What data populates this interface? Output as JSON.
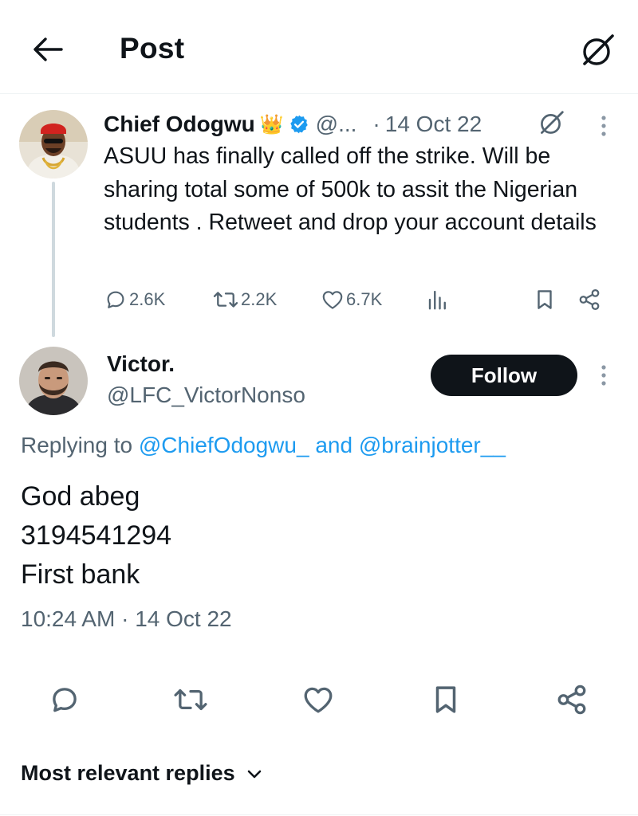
{
  "header": {
    "title": "Post",
    "back_icon": "arrow-left-icon",
    "grok_icon": "grok-icon"
  },
  "parent_tweet": {
    "author_name": "Chief Odogwu",
    "crown_emoji": "👑",
    "handle": "@...",
    "dot": "·",
    "date": "14 Oct 22",
    "text": "ASUU has finally called off the strike. Will be sharing total some of 500k to assit the Nigerian students  . Retweet and drop your account details",
    "replies": "2.6K",
    "reposts": "2.2K",
    "likes": "6.7K"
  },
  "reply_tweet": {
    "author_name": "Victor.",
    "handle": "@LFC_VictorNonso",
    "follow_label": "Follow",
    "replying_prefix": "Replying to",
    "replying_mention_1": "@ChiefOdogwu_",
    "replying_and": "and",
    "replying_mention_2": "@brainjotter__",
    "body_line_1": "God abeg",
    "body_line_2": "3194541294",
    "body_line_3": "First bank",
    "time": "10:24 AM",
    "time_dot": "·",
    "date": "14 Oct 22"
  },
  "sort": {
    "label": "Most relevant replies"
  },
  "colors": {
    "text_primary": "#0f1419",
    "text_secondary": "#536471",
    "accent": "#1d9bf0",
    "verified": "#1d9bf0",
    "follow_bg": "#0f1419",
    "divider": "#eff3f4"
  }
}
